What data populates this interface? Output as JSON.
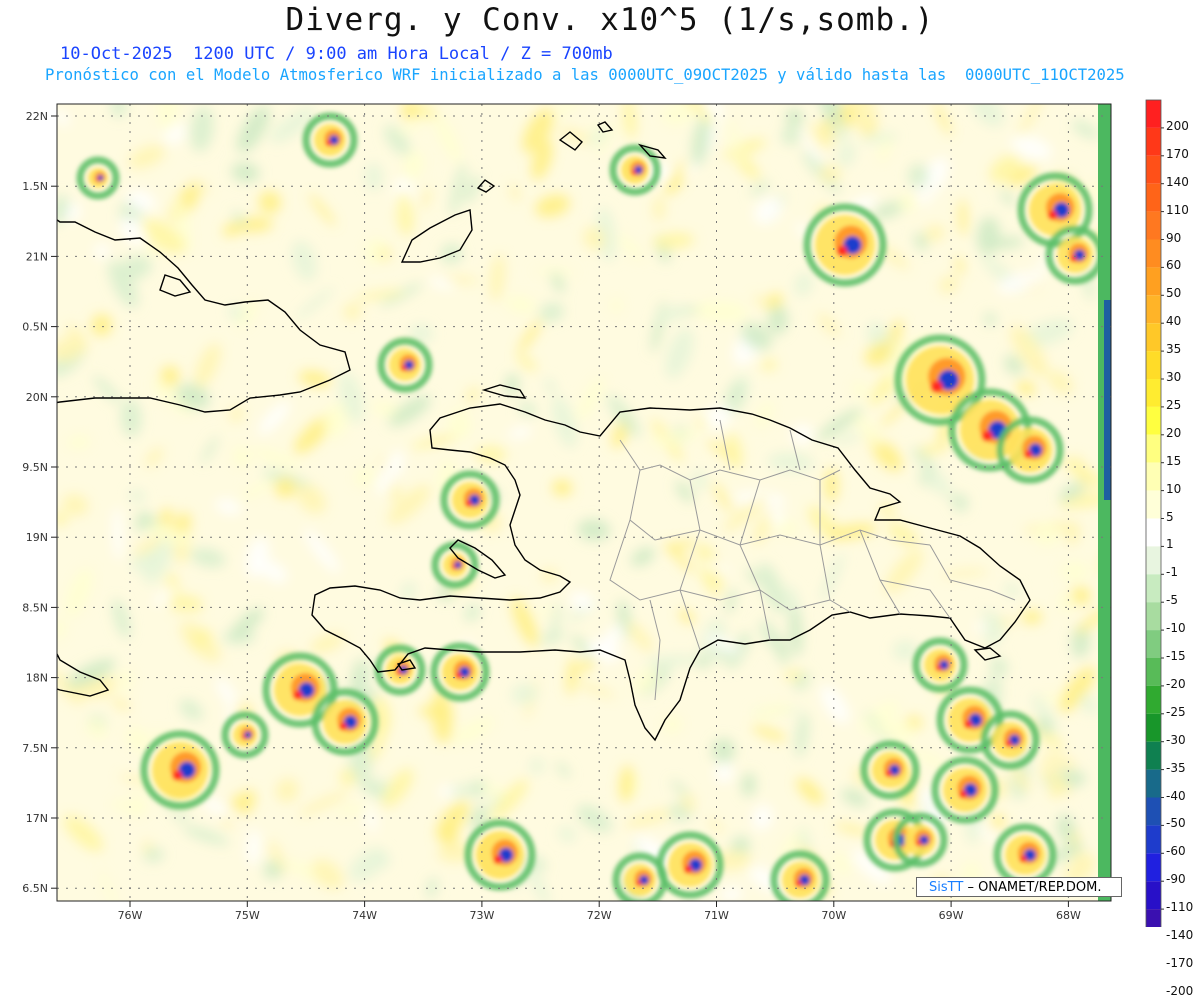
{
  "header": {
    "title": "Diverg. y Conv. x10^5 (1/s,somb.)",
    "subtitle_time": "10-Oct-2025  1200 UTC / 9:00 am Hora Local / Z = 700mb",
    "subtitle_model": "Pronóstico con el Modelo Atmosferico WRF inicializado a las 0000UTC_09OCT2025 y válido hasta las  0000UTC_11OCT2025"
  },
  "map": {
    "lat_labels": [
      "22N",
      "1.5N",
      "21N",
      "0.5N",
      "20N",
      "9.5N",
      "19N",
      "8.5N",
      "18N",
      "7.5N",
      "17N",
      "6.5N"
    ],
    "lon_labels": [
      "76W",
      "75W",
      "74W",
      "73W",
      "72W",
      "71W",
      "70W",
      "69W",
      "68W"
    ]
  },
  "colorbar": {
    "labels": [
      "200",
      "170",
      "140",
      "110",
      "90",
      "60",
      "50",
      "40",
      "35",
      "30",
      "25",
      "20",
      "15",
      "10",
      "5",
      "1",
      "-1",
      "-5",
      "-10",
      "-15",
      "-20",
      "-25",
      "-30",
      "-35",
      "-40",
      "-50",
      "-60",
      "-90",
      "-110",
      "-140",
      "-170",
      "-200"
    ],
    "colors": [
      "#ff2020",
      "#ff3818",
      "#ff5018",
      "#ff6418",
      "#ff7820",
      "#ff8c20",
      "#ffa020",
      "#ffb428",
      "#ffc828",
      "#ffdc28",
      "#ffec30",
      "#ffff40",
      "#ffff80",
      "#ffffb4",
      "#ffffd8",
      "#ffffff",
      "#e8f5e0",
      "#c8ebc0",
      "#a8dca0",
      "#80cc80",
      "#58bb58",
      "#30aa30",
      "#18962a",
      "#0f8050",
      "#186a8a",
      "#1e50b4",
      "#1e3ccc",
      "#2020e0",
      "#2810c8",
      "#3a10b0",
      "#48109a",
      "#580c88"
    ]
  },
  "credit": {
    "logo": "SisTT",
    "text": "– ONAMET/REP.DOM."
  }
}
